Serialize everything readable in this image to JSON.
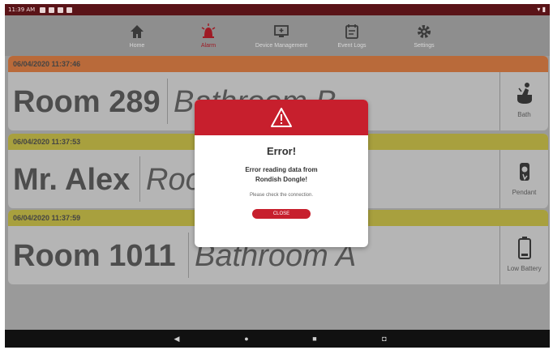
{
  "status_bar": {
    "time": "11:39 AM"
  },
  "nav": {
    "items": [
      {
        "label": "Home",
        "icon": "home-icon",
        "active": false
      },
      {
        "label": "Alarm",
        "icon": "alarm-icon",
        "active": true
      },
      {
        "label": "Device Management",
        "icon": "device-management-icon",
        "active": false
      },
      {
        "label": "Event Logs",
        "icon": "event-logs-icon",
        "active": false
      },
      {
        "label": "Settings",
        "icon": "gear-icon",
        "active": false
      }
    ]
  },
  "alarms": [
    {
      "timestamp": "06/04/2020 11:37:46",
      "who": "Room 289",
      "where": "Bathroom B",
      "type": "Bath",
      "icon": "bath-icon",
      "header_color": "#b96a3a"
    },
    {
      "timestamp": "06/04/2020 11:37:53",
      "who": "Mr. Alex",
      "where": "Room",
      "type": "Pendant",
      "icon": "pendant-icon",
      "header_color": "#a8a03e"
    },
    {
      "timestamp": "06/04/2020 11:37:59",
      "who": "Room 1011",
      "where": "Bathroom A",
      "type": "Low Battery",
      "icon": "low-battery-icon",
      "header_color": "#a8a03e"
    }
  ],
  "dialog": {
    "title": "Error!",
    "message_line1": "Error reading data from",
    "message_line2": "Rondish Dongle!",
    "sub_message": "Please check the connection.",
    "close_label": "CLOSE",
    "icon": "warning-icon",
    "accent_color": "#c71f2d"
  },
  "system_nav": {
    "back": "◀",
    "home": "●",
    "recents": "■",
    "screenshot": "◘"
  }
}
